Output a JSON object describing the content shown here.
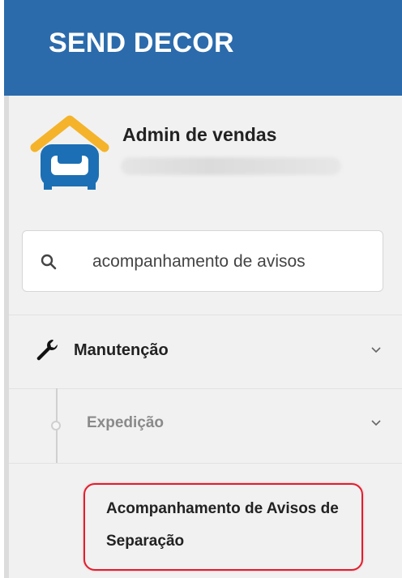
{
  "header": {
    "brand": "SEND DECOR",
    "color": "#2b6bac"
  },
  "user": {
    "name": "Admin de vendas",
    "avatar_icon": "armchair-house-icon"
  },
  "search": {
    "value": "acompanhamento de avisos",
    "icon": "search-icon"
  },
  "menu": {
    "top_item": {
      "label": "Manutenção",
      "icon": "wrench-icon",
      "expanded": true
    },
    "sub_item": {
      "label": "Expedição",
      "expanded": true
    },
    "leaf_item": {
      "label": "Acompanhamento de Avisos de Separação",
      "highlight_color": "#e21d2d"
    }
  }
}
